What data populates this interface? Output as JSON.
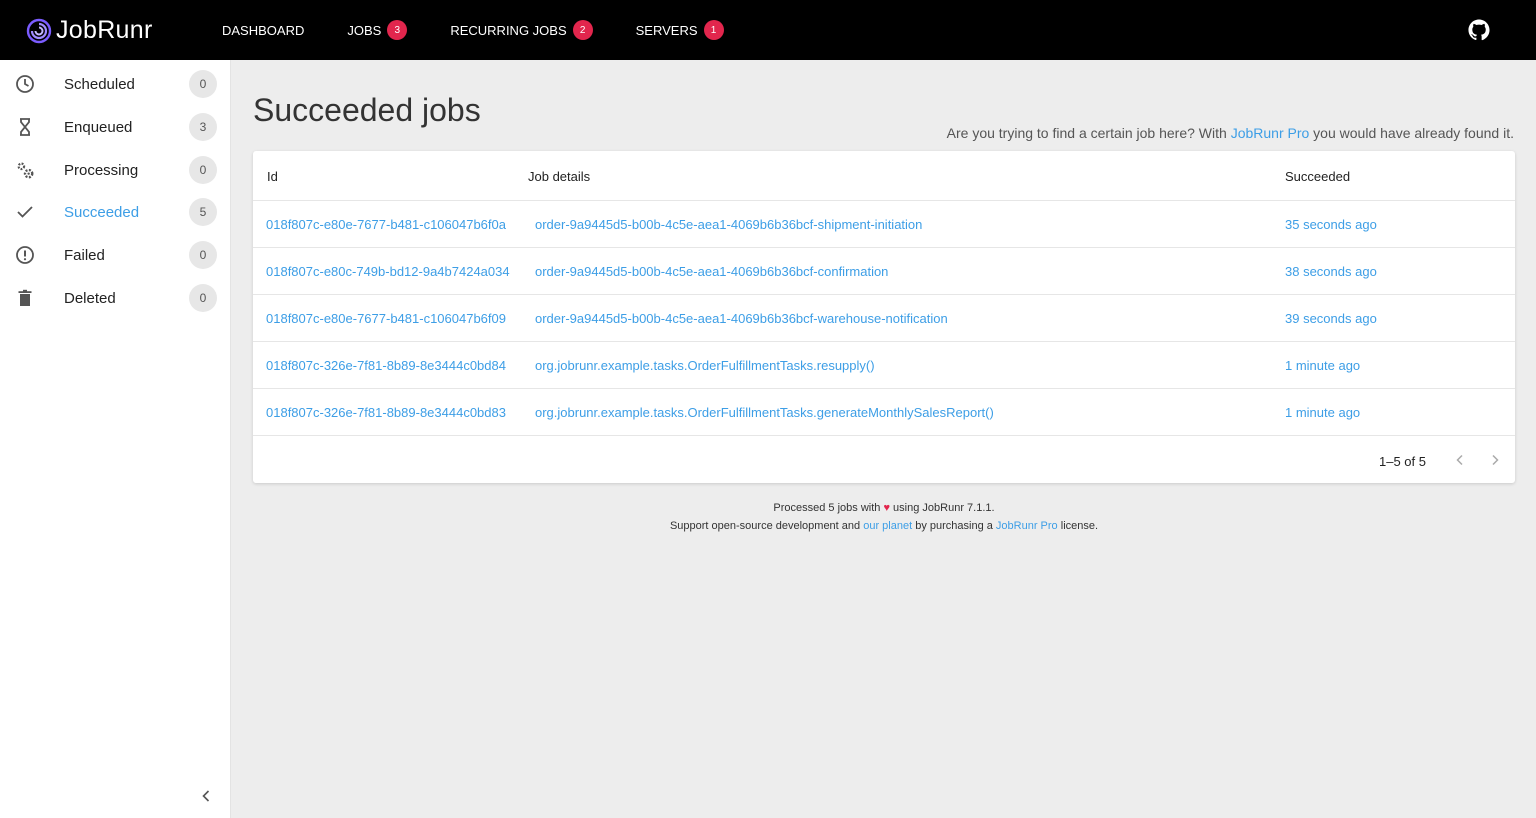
{
  "app": {
    "name": "JobRunr"
  },
  "nav": [
    {
      "label": "DASHBOARD",
      "badge": null
    },
    {
      "label": "JOBS",
      "badge": "3"
    },
    {
      "label": "RECURRING JOBS",
      "badge": "2"
    },
    {
      "label": "SERVERS",
      "badge": "1"
    }
  ],
  "sidebar": {
    "items": [
      {
        "label": "Scheduled",
        "count": "0",
        "icon": "clock-icon"
      },
      {
        "label": "Enqueued",
        "count": "3",
        "icon": "hourglass-icon"
      },
      {
        "label": "Processing",
        "count": "0",
        "icon": "gears-icon"
      },
      {
        "label": "Succeeded",
        "count": "5",
        "icon": "check-icon"
      },
      {
        "label": "Failed",
        "count": "0",
        "icon": "alert-icon"
      },
      {
        "label": "Deleted",
        "count": "0",
        "icon": "trash-icon"
      }
    ],
    "active_index": 3
  },
  "main": {
    "title": "Succeeded jobs",
    "promo": {
      "before": "Are you trying to find a certain job here? With ",
      "link": "JobRunr Pro",
      "after": " you would have already found it."
    },
    "table": {
      "columns": [
        "Id",
        "Job details",
        "Succeeded"
      ],
      "rows": [
        {
          "id": "018f807c-e80e-7677-b481-c106047b6f0a",
          "details": "order-9a9445d5-b00b-4c5e-aea1-4069b6b36bcf-shipment-initiation",
          "succeeded": "35 seconds ago"
        },
        {
          "id": "018f807c-e80c-749b-bd12-9a4b7424a034",
          "details": "order-9a9445d5-b00b-4c5e-aea1-4069b6b36bcf-confirmation",
          "succeeded": "38 seconds ago"
        },
        {
          "id": "018f807c-e80e-7677-b481-c106047b6f09",
          "details": "order-9a9445d5-b00b-4c5e-aea1-4069b6b36bcf-warehouse-notification",
          "succeeded": "39 seconds ago"
        },
        {
          "id": "018f807c-326e-7f81-8b89-8e3444c0bd84",
          "details": "org.jobrunr.example.tasks.OrderFulfillmentTasks.resupply()",
          "succeeded": "1 minute ago"
        },
        {
          "id": "018f807c-326e-7f81-8b89-8e3444c0bd83",
          "details": "org.jobrunr.example.tasks.OrderFulfillmentTasks.generateMonthlySalesReport()",
          "succeeded": "1 minute ago"
        }
      ]
    },
    "pagination": {
      "text": "1–5 of 5"
    }
  },
  "footer": {
    "line1_before": "Processed 5 jobs with ",
    "heart": "♥",
    "line1_after": " using JobRunr 7.1.1.",
    "line2_before": "Support open-source development and ",
    "line2_link1": "our planet",
    "line2_middle": " by purchasing a ",
    "line2_link2": "JobRunr Pro",
    "line2_after": " license."
  },
  "colors": {
    "accent": "#3d9ee6",
    "badge": "#e2264d",
    "topbar": "#000000"
  }
}
